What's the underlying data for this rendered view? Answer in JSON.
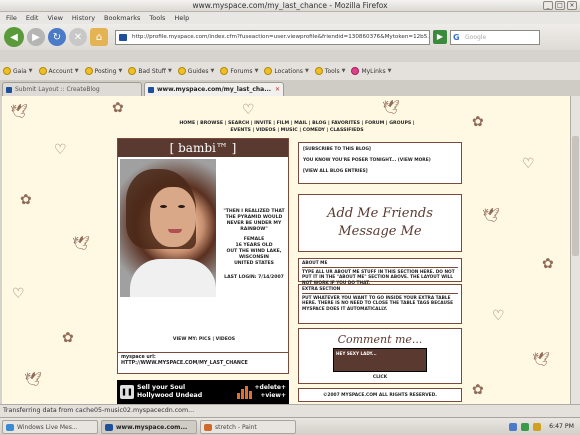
{
  "window": {
    "title": "www.myspace.com/my_last_chance - Mozilla Firefox"
  },
  "menu": [
    "File",
    "Edit",
    "View",
    "History",
    "Bookmarks",
    "Tools",
    "Help"
  ],
  "nav": {
    "url": "http://profile.myspace.com/index.cfm?fuseaction=user.viewprofile&friendid=130860376&Mytoken=12b5...",
    "search_placeholder": "Google"
  },
  "bookmarks": [
    {
      "label": "Gaia",
      "icon": "smiley-icon"
    },
    {
      "label": "Account",
      "icon": "smiley-icon"
    },
    {
      "label": "Posting",
      "icon": "smiley-icon"
    },
    {
      "label": "Bad Stuff",
      "icon": "smiley-icon"
    },
    {
      "label": "Guides",
      "icon": "smiley-icon"
    },
    {
      "label": "Forums",
      "icon": "smiley-icon"
    },
    {
      "label": "Locations",
      "icon": "smiley-icon"
    },
    {
      "label": "Tools",
      "icon": "smiley-icon"
    },
    {
      "label": "MyLinks",
      "icon": "heart-icon"
    }
  ],
  "tabs": [
    {
      "label": "Submit Layout :: CreateBlog",
      "active": false
    },
    {
      "label": "www.myspace.com/my_last_cha...",
      "active": true
    }
  ],
  "page": {
    "topnav_1": "HOME | BROWSE | SEARCH | INVITE | FILM | MAIL | BLOG | FAVORITES | FORUM | GROUPS |",
    "topnav_2": "EVENTS | VIDEOS | MUSIC | COMEDY | CLASSIFIEDS",
    "name": "[ bambi™ ]",
    "quote": "\"THEN I REALIZED THAT THE PYRAMID WOULD NEVER BE UNDER MY RAINBOW\"",
    "gender": "FEMALE",
    "age": "16 YEARS OLD",
    "location1": "OUT THE WIND LAKE,",
    "location2": "WISCONSIN",
    "country": "UNITED STATES",
    "last_login": "LAST LOGIN: 7/14/2007",
    "view_pics": "VIEW MY: PICS | VIDEOS",
    "url_label": "myspace url:",
    "url_value": "HTTP://WWW.MYSPACE.COM/MY_LAST_CHANCE",
    "music_line1": "Sell your Soul",
    "music_line2": "Hollywood Undead",
    "music_delete": "+delete+",
    "music_view": "+view+",
    "blog_subscribe": "[SUBSCRIBE TO THIS BLOG]",
    "blog_entry": "YOU KNOW YOU'RE POSER TONIGHT... (VIEW MORE)",
    "blog_viewall": "[VIEW ALL BLOG ENTRIES]",
    "addme_1": "Add Me Friends",
    "addme_2": "Message Me",
    "about_head": "ABOUT ME",
    "about_text": "TYPE ALL UR ABOUT ME STUFF IN THIS SECTION HERE. DO NOT PUT IT IN THE \"ABOUT ME\" SECTION ABOVE. THE LAYOUT WILL NOT WORK IF YOU DO THAT.",
    "extra_head": "EXTRA SECTION",
    "extra_text": "PUT WHATEVER YOU WANT TO GO INSIDE YOUR EXTRA TABLE HERE. THERE IS NO NEED TO CLOSE THE TABLE TAGS BECAUSE MYSPACE DOES IT AUTOMATICALLY.",
    "comments_title": "Comment me...",
    "comments_box": "HEY SEXY LADY...",
    "comments_click": "CLICK",
    "copyright": "©2007 MYSPACE.COM ALL RIGHTS RESERVED."
  },
  "status": "Transferring data from cache05-music02.myspacecdn.com...",
  "taskbar": [
    {
      "label": "Windows Live Mes...",
      "color": "#3b8ad4",
      "active": false
    },
    {
      "label": "www.myspace.com...",
      "color": "#1e4f9a",
      "active": true
    },
    {
      "label": "stretch - Paint",
      "color": "#d06a2a",
      "active": false
    }
  ],
  "clock": "6:47 PM"
}
